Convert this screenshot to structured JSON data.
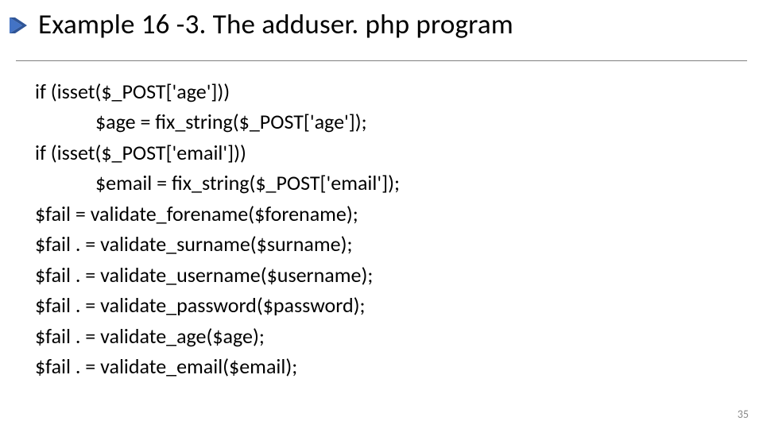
{
  "slide": {
    "title": "Example 16 -3. The adduser. php program",
    "page_number": "35",
    "code": {
      "l1": "if (isset($_POST['age']))",
      "l2": "$age = fix_string($_POST['age']);",
      "l3": "if (isset($_POST['email']))",
      "l4": "$email = fix_string($_POST['email']);",
      "l5": "$fail = validate_forename($forename);",
      "l6": "$fail . = validate_surname($surname);",
      "l7": "$fail . = validate_username($username);",
      "l8": "$fail . = validate_password($password);",
      "l9": "$fail . = validate_age($age);",
      "l10": "$fail . = validate_email($email);"
    }
  }
}
